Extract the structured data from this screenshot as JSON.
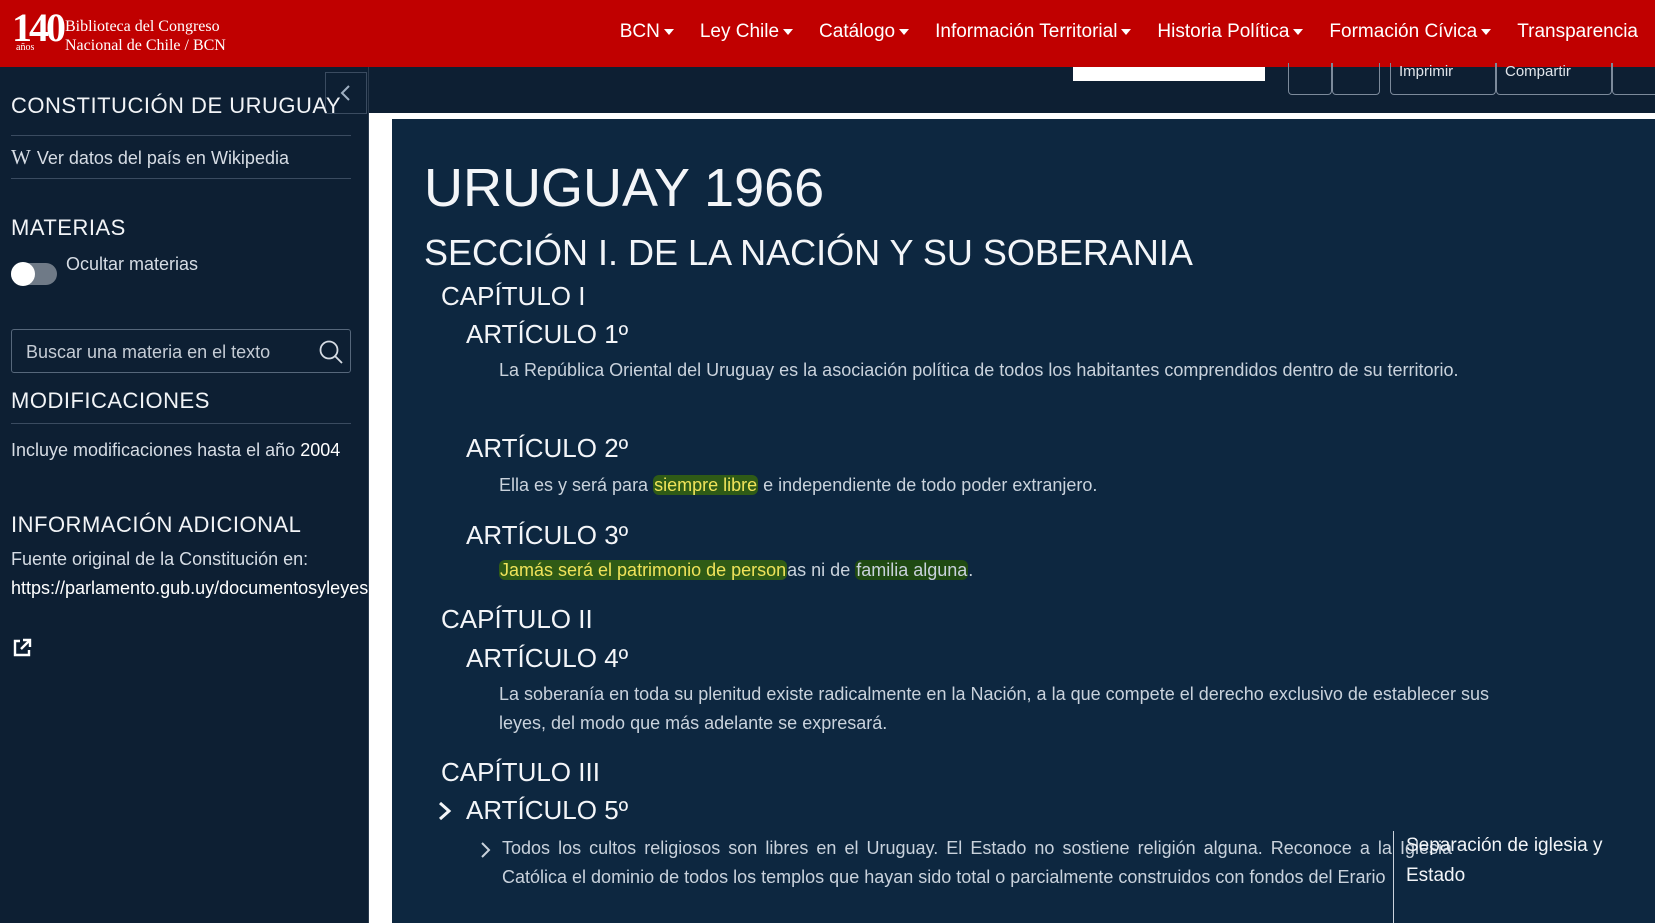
{
  "header": {
    "logo_number": "140",
    "logo_anos": "años",
    "logo_line1": "Biblioteca del Congreso",
    "logo_line2": "Nacional de Chile / BCN",
    "nav": [
      {
        "label": "BCN"
      },
      {
        "label": "Ley Chile"
      },
      {
        "label": "Catálogo"
      },
      {
        "label": "Información Territorial"
      },
      {
        "label": "Historia Política"
      },
      {
        "label": "Formación Cívica"
      },
      {
        "label": "Transparencia"
      }
    ]
  },
  "toolbar": {
    "print_label": "Imprimir",
    "share_label": "Compartir"
  },
  "sidebar": {
    "title": "CONSTITUCIÓN DE URUGUAY",
    "wiki_letter": "W",
    "wiki_link": "Ver datos del país en Wikipedia",
    "materias_title": "MATERIAS",
    "toggle_label": "Ocultar materias",
    "search_placeholder": "Buscar una materia en el texto",
    "modificaciones_title": "MODIFICACIONES",
    "modificaciones_text": "Incluye modificaciones hasta el año",
    "modificaciones_year": "2004",
    "info_title": "INFORMACIÓN ADICIONAL",
    "info_text": "Fuente original de la Constitución en:",
    "info_link": "https://parlamento.gub.uy/documentosyleyes"
  },
  "document": {
    "title": "URUGUAY 1966",
    "section": "SECCIÓN I. DE LA NACIÓN Y SU SOBERANIA",
    "cap1": "CAPÍTULO I",
    "art1": "ARTÍCULO 1º",
    "art1_text": "La República Oriental del Uruguay es la asociación política de todos los habitantes comprendidos dentro de su territorio.",
    "art2": "ARTÍCULO 2º",
    "art2_pre": "Ella es y será para ",
    "art2_hl": "siempre libre",
    "art2_post": " e independiente de todo poder extranjero.",
    "art3": "ARTÍCULO 3º",
    "art3_hl1": "Jamás será el patrimonio de person",
    "art3_mid": "as ni de ",
    "art3_hl2": "familia alguna",
    "art3_end": ".",
    "cap2": "CAPÍTULO II",
    "art4": "ARTÍCULO 4º",
    "art4_text": "La soberanía en toda su plenitud existe radicalmente en la Nación, a la que compete el derecho exclusivo de establecer sus leyes, del modo que más adelante se expresará.",
    "cap3": "CAPÍTULO III",
    "art5": "ARTÍCULO 5º",
    "art5_text": "Todos los cultos religiosos son libres en el Uruguay. El Estado no sostiene religión alguna. Reconoce a la Iglesia Católica el dominio de todos los templos que hayan sido total o parcialmente construidos con fondos del Erario",
    "side_note": "Separación de iglesia y Estado"
  }
}
